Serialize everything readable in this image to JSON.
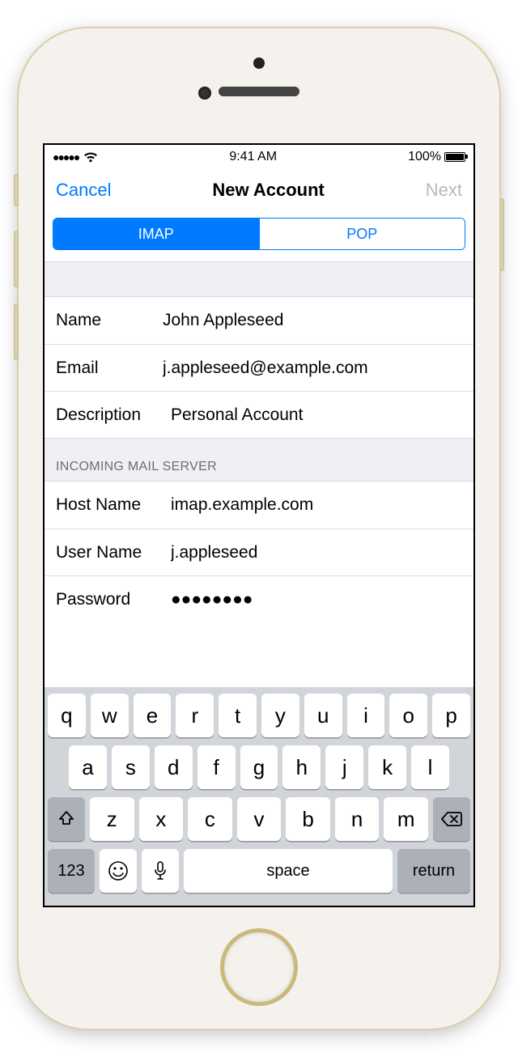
{
  "status": {
    "time": "9:41 AM",
    "battery_pct": "100%"
  },
  "nav": {
    "cancel": "Cancel",
    "title": "New Account",
    "next": "Next"
  },
  "segments": {
    "imap": "IMAP",
    "pop": "POP"
  },
  "account": {
    "name_label": "Name",
    "name_value": "John Appleseed",
    "email_label": "Email",
    "email_value": "j.appleseed@example.com",
    "desc_label": "Description",
    "desc_value": "Personal Account"
  },
  "incoming": {
    "header": "INCOMING MAIL SERVER",
    "host_label": "Host Name",
    "host_value": "imap.example.com",
    "user_label": "User Name",
    "user_value": "j.appleseed",
    "pwd_label": "Password",
    "pwd_value": "●●●●●●●●"
  },
  "keyboard": {
    "row1": [
      "q",
      "w",
      "e",
      "r",
      "t",
      "y",
      "u",
      "i",
      "o",
      "p"
    ],
    "row2": [
      "a",
      "s",
      "d",
      "f",
      "g",
      "h",
      "j",
      "k",
      "l"
    ],
    "row3": [
      "z",
      "x",
      "c",
      "v",
      "b",
      "n",
      "m"
    ],
    "k123": "123",
    "space": "space",
    "ret": "return"
  }
}
